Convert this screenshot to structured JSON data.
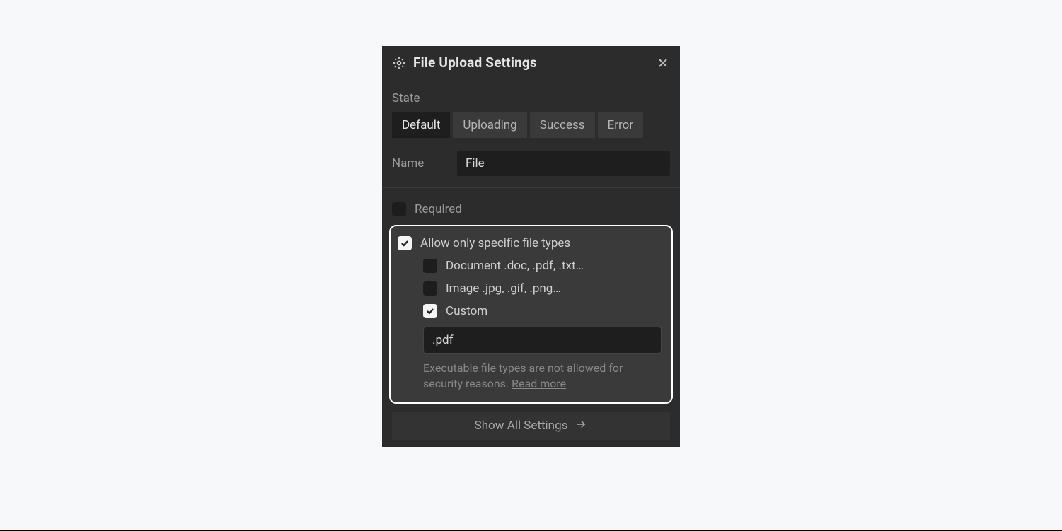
{
  "header": {
    "title": "File Upload Settings"
  },
  "state": {
    "label": "State",
    "options": [
      "Default",
      "Uploading",
      "Success",
      "Error"
    ],
    "active_index": 0
  },
  "name": {
    "label": "Name",
    "value": "File"
  },
  "options": {
    "required_label": "Required",
    "required_checked": false,
    "allow_specific_label": "Allow only specific file types",
    "allow_specific_checked": true,
    "types": [
      {
        "label": "Document .doc, .pdf, .txt…",
        "checked": false
      },
      {
        "label": "Image .jpg, .gif, .png…",
        "checked": false
      },
      {
        "label": "Custom",
        "checked": true
      }
    ],
    "custom_value": ".pdf",
    "hint_text": "Executable file types are not allowed for security reasons. ",
    "hint_link": "Read more"
  },
  "footer": {
    "show_all_label": "Show All Settings"
  }
}
